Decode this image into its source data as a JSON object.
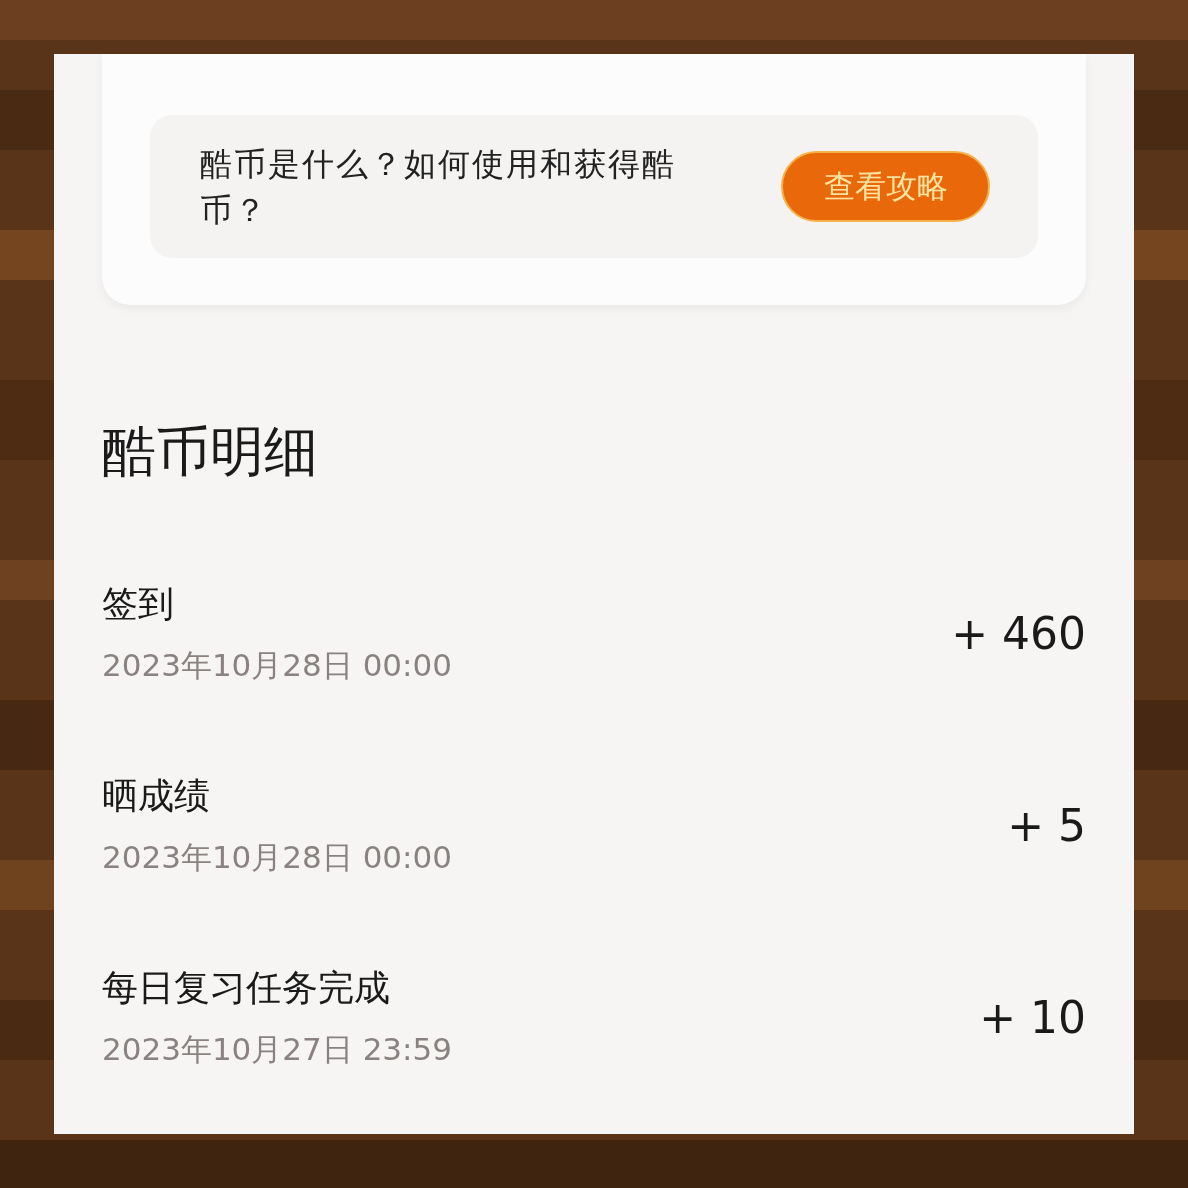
{
  "info_card": {
    "question": "酷币是什么？如何使用和获得酷币？",
    "button": "查看攻略"
  },
  "details": {
    "title": "酷币明细",
    "rows": [
      {
        "name": "签到",
        "time": "2023年10月28日 00:00",
        "amount": "+ 460"
      },
      {
        "name": "晒成绩",
        "time": "2023年10月28日 00:00",
        "amount": "+ 5"
      },
      {
        "name": "每日复习任务完成",
        "time": "2023年10月27日 23:59",
        "amount": "+ 10"
      }
    ]
  }
}
